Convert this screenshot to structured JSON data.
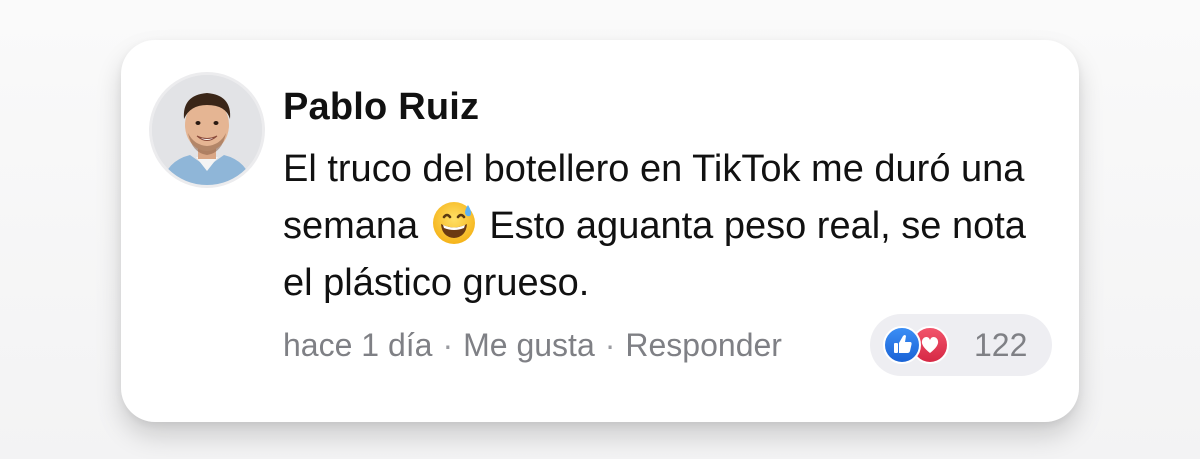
{
  "comment": {
    "author": "Pablo Ruiz",
    "text_part1": "El truco del botellero en TikTok me duró una semana",
    "emoji": "grinning-face-with-sweat-emoji",
    "text_part2": "Esto aguanta peso real, se nota el plástico grueso."
  },
  "meta": {
    "time": "hace 1 día",
    "separator": "·",
    "like_label": "Me gusta",
    "reply_label": "Responder"
  },
  "reactions": {
    "icons": [
      "like-icon",
      "love-icon"
    ],
    "count": "122"
  },
  "colors": {
    "like": "#1a63d6",
    "love": "#d62845",
    "meta_text": "#7f8085",
    "body_text": "#111111"
  }
}
